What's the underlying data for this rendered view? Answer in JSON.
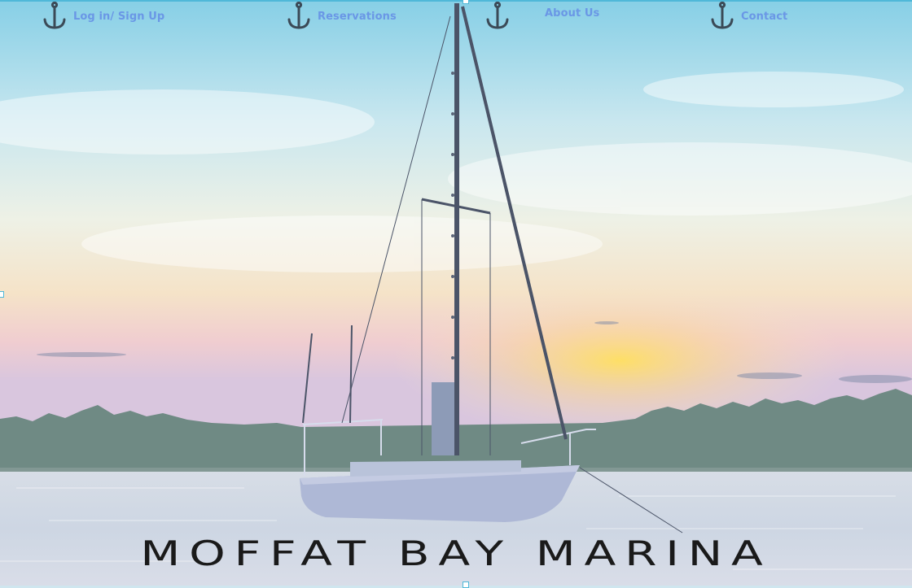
{
  "nav": {
    "items": [
      {
        "label": "Log in/ Sign Up",
        "icon": "anchor-icon"
      },
      {
        "label": "Reservations",
        "icon": "anchor-icon"
      },
      {
        "label": "About Us",
        "icon": "anchor-icon"
      },
      {
        "label": "Contact",
        "icon": "anchor-icon"
      }
    ]
  },
  "hero": {
    "title": "MOFFAT BAY MARINA",
    "image": "sailboat-at-sunset"
  },
  "colors": {
    "nav_link": "#6a97e6",
    "anchor": "#3b4a57",
    "title": "#1a1a1a"
  }
}
